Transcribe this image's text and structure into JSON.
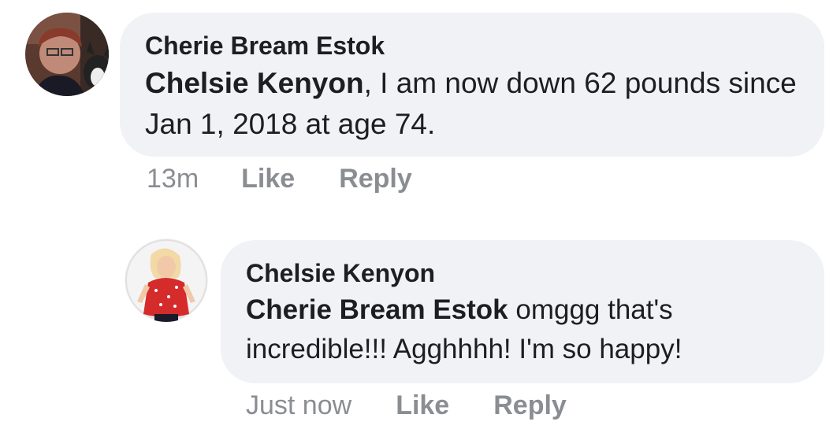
{
  "comments": [
    {
      "author": "Cherie Bream Estok",
      "mention": "Chelsie Kenyon",
      "text": ", I am now down 62 pounds since Jan 1, 2018 at age 74.",
      "time": "13m",
      "like_label": "Like",
      "reply_label": "Reply"
    },
    {
      "author": "Chelsie Kenyon",
      "mention": "Cherie Bream Estok",
      "text": " omggg that's incredible!!! Agghhhh! I'm so happy!",
      "time": "Just now",
      "like_label": "Like",
      "reply_label": "Reply"
    }
  ],
  "colors": {
    "bubble": "#f0f2f5",
    "text": "#1c1e21",
    "meta": "#8a8d91"
  }
}
